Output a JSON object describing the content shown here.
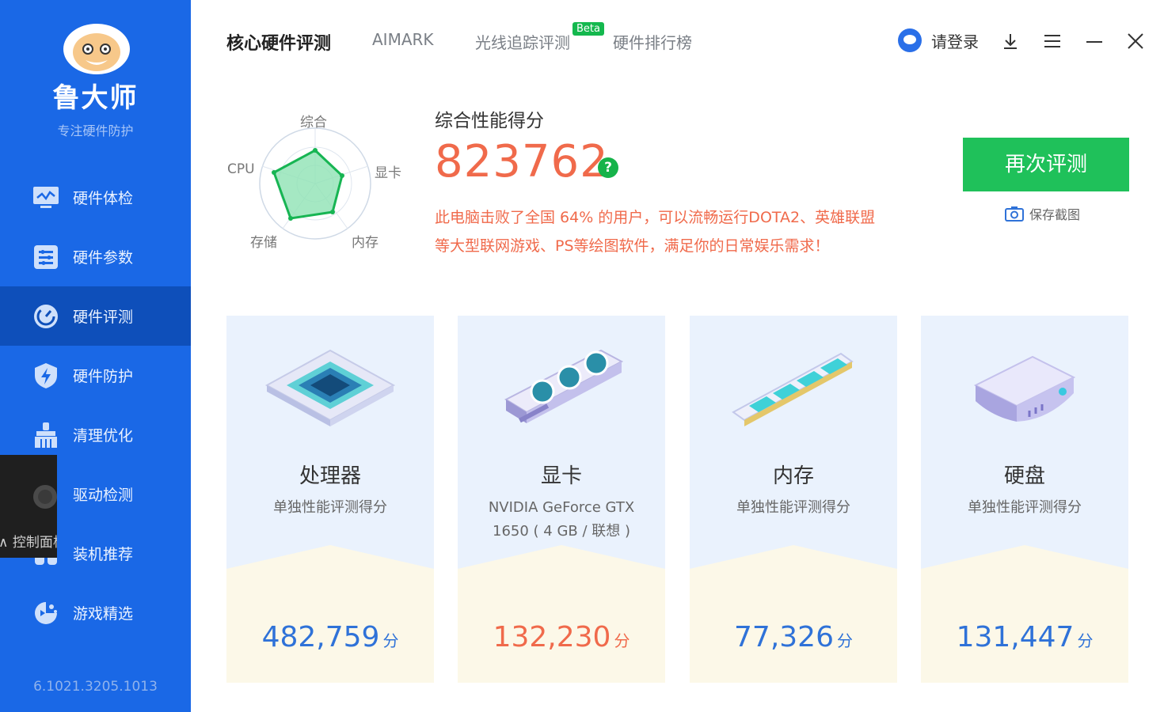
{
  "sidebar": {
    "brand": "鲁大师",
    "slogan": "专注硬件防护",
    "items": [
      {
        "label": "硬件体检",
        "icon": "monitor-icon",
        "active": false
      },
      {
        "label": "硬件参数",
        "icon": "list-icon",
        "active": false
      },
      {
        "label": "硬件评测",
        "icon": "gauge-icon",
        "active": true
      },
      {
        "label": "硬件防护",
        "icon": "shield-bolt-icon",
        "active": false
      },
      {
        "label": "清理优化",
        "icon": "broom-icon",
        "active": false
      },
      {
        "label": "驱动检测",
        "icon": "gear-icon",
        "active": false
      },
      {
        "label": "装机推荐",
        "icon": "build-icon",
        "active": false
      },
      {
        "label": "游戏精选",
        "icon": "game-icon",
        "active": false
      }
    ],
    "version": "6.1021.3205.1013",
    "overlay_text": "控制面板"
  },
  "header": {
    "tabs": [
      {
        "label": "核心硬件评测",
        "active": true
      },
      {
        "label": "AIMARK",
        "active": false
      },
      {
        "label": "光线追踪评测",
        "active": false,
        "badge": "Beta"
      },
      {
        "label": "硬件排行榜",
        "active": false
      }
    ],
    "login_label": "请登录"
  },
  "radar": {
    "labels": {
      "top": "综合",
      "right": "显卡",
      "bottom_right": "内存",
      "bottom_left": "存储",
      "left": "CPU"
    }
  },
  "score": {
    "title": "综合性能得分",
    "value": "823762",
    "help_icon": "?",
    "desc_line1": "此电脑击败了全国 64% 的用户，可以流畅运行DOTA2、英雄联盟",
    "desc_line2": "等大型联网游戏、PS等绘图软件，满足你的日常娱乐需求！",
    "retest_label": "再次评测",
    "save_label": "保存截图"
  },
  "cards": [
    {
      "name": "处理器",
      "sub1": "单独性能评测得分",
      "sub2": "",
      "score": "482,759",
      "unit": "分",
      "color": "#2f72d8"
    },
    {
      "name": "显卡",
      "sub1": "NVIDIA GeForce GTX",
      "sub2": "1650 ( 4 GB / 联想 )",
      "score": "132,230",
      "unit": "分",
      "color": "#f06a4b"
    },
    {
      "name": "内存",
      "sub1": "单独性能评测得分",
      "sub2": "",
      "score": "77,326",
      "unit": "分",
      "color": "#2f72d8"
    },
    {
      "name": "硬盘",
      "sub1": "单独性能评测得分",
      "sub2": "",
      "score": "131,447",
      "unit": "分",
      "color": "#2f72d8"
    }
  ],
  "colors": {
    "sidebar": "#1a68e6",
    "accent_green": "#1fc15a",
    "score_orange": "#f06a4b",
    "score_blue": "#2f72d8"
  }
}
